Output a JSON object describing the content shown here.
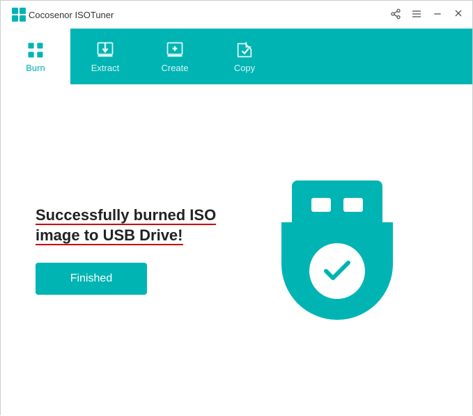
{
  "titleBar": {
    "appName": "Cocosenor ISOTuner"
  },
  "tabs": [
    {
      "id": "burn",
      "label": "Burn",
      "active": true
    },
    {
      "id": "extract",
      "label": "Extract",
      "active": false
    },
    {
      "id": "create",
      "label": "Create",
      "active": false
    },
    {
      "id": "copy",
      "label": "Copy",
      "active": false
    }
  ],
  "mainContent": {
    "successMessage": "Successfully burned ISO image to USB Drive!",
    "finishedButton": "Finished"
  },
  "colors": {
    "accent": "#00b4b4",
    "underlineRed": "#cc0000"
  }
}
